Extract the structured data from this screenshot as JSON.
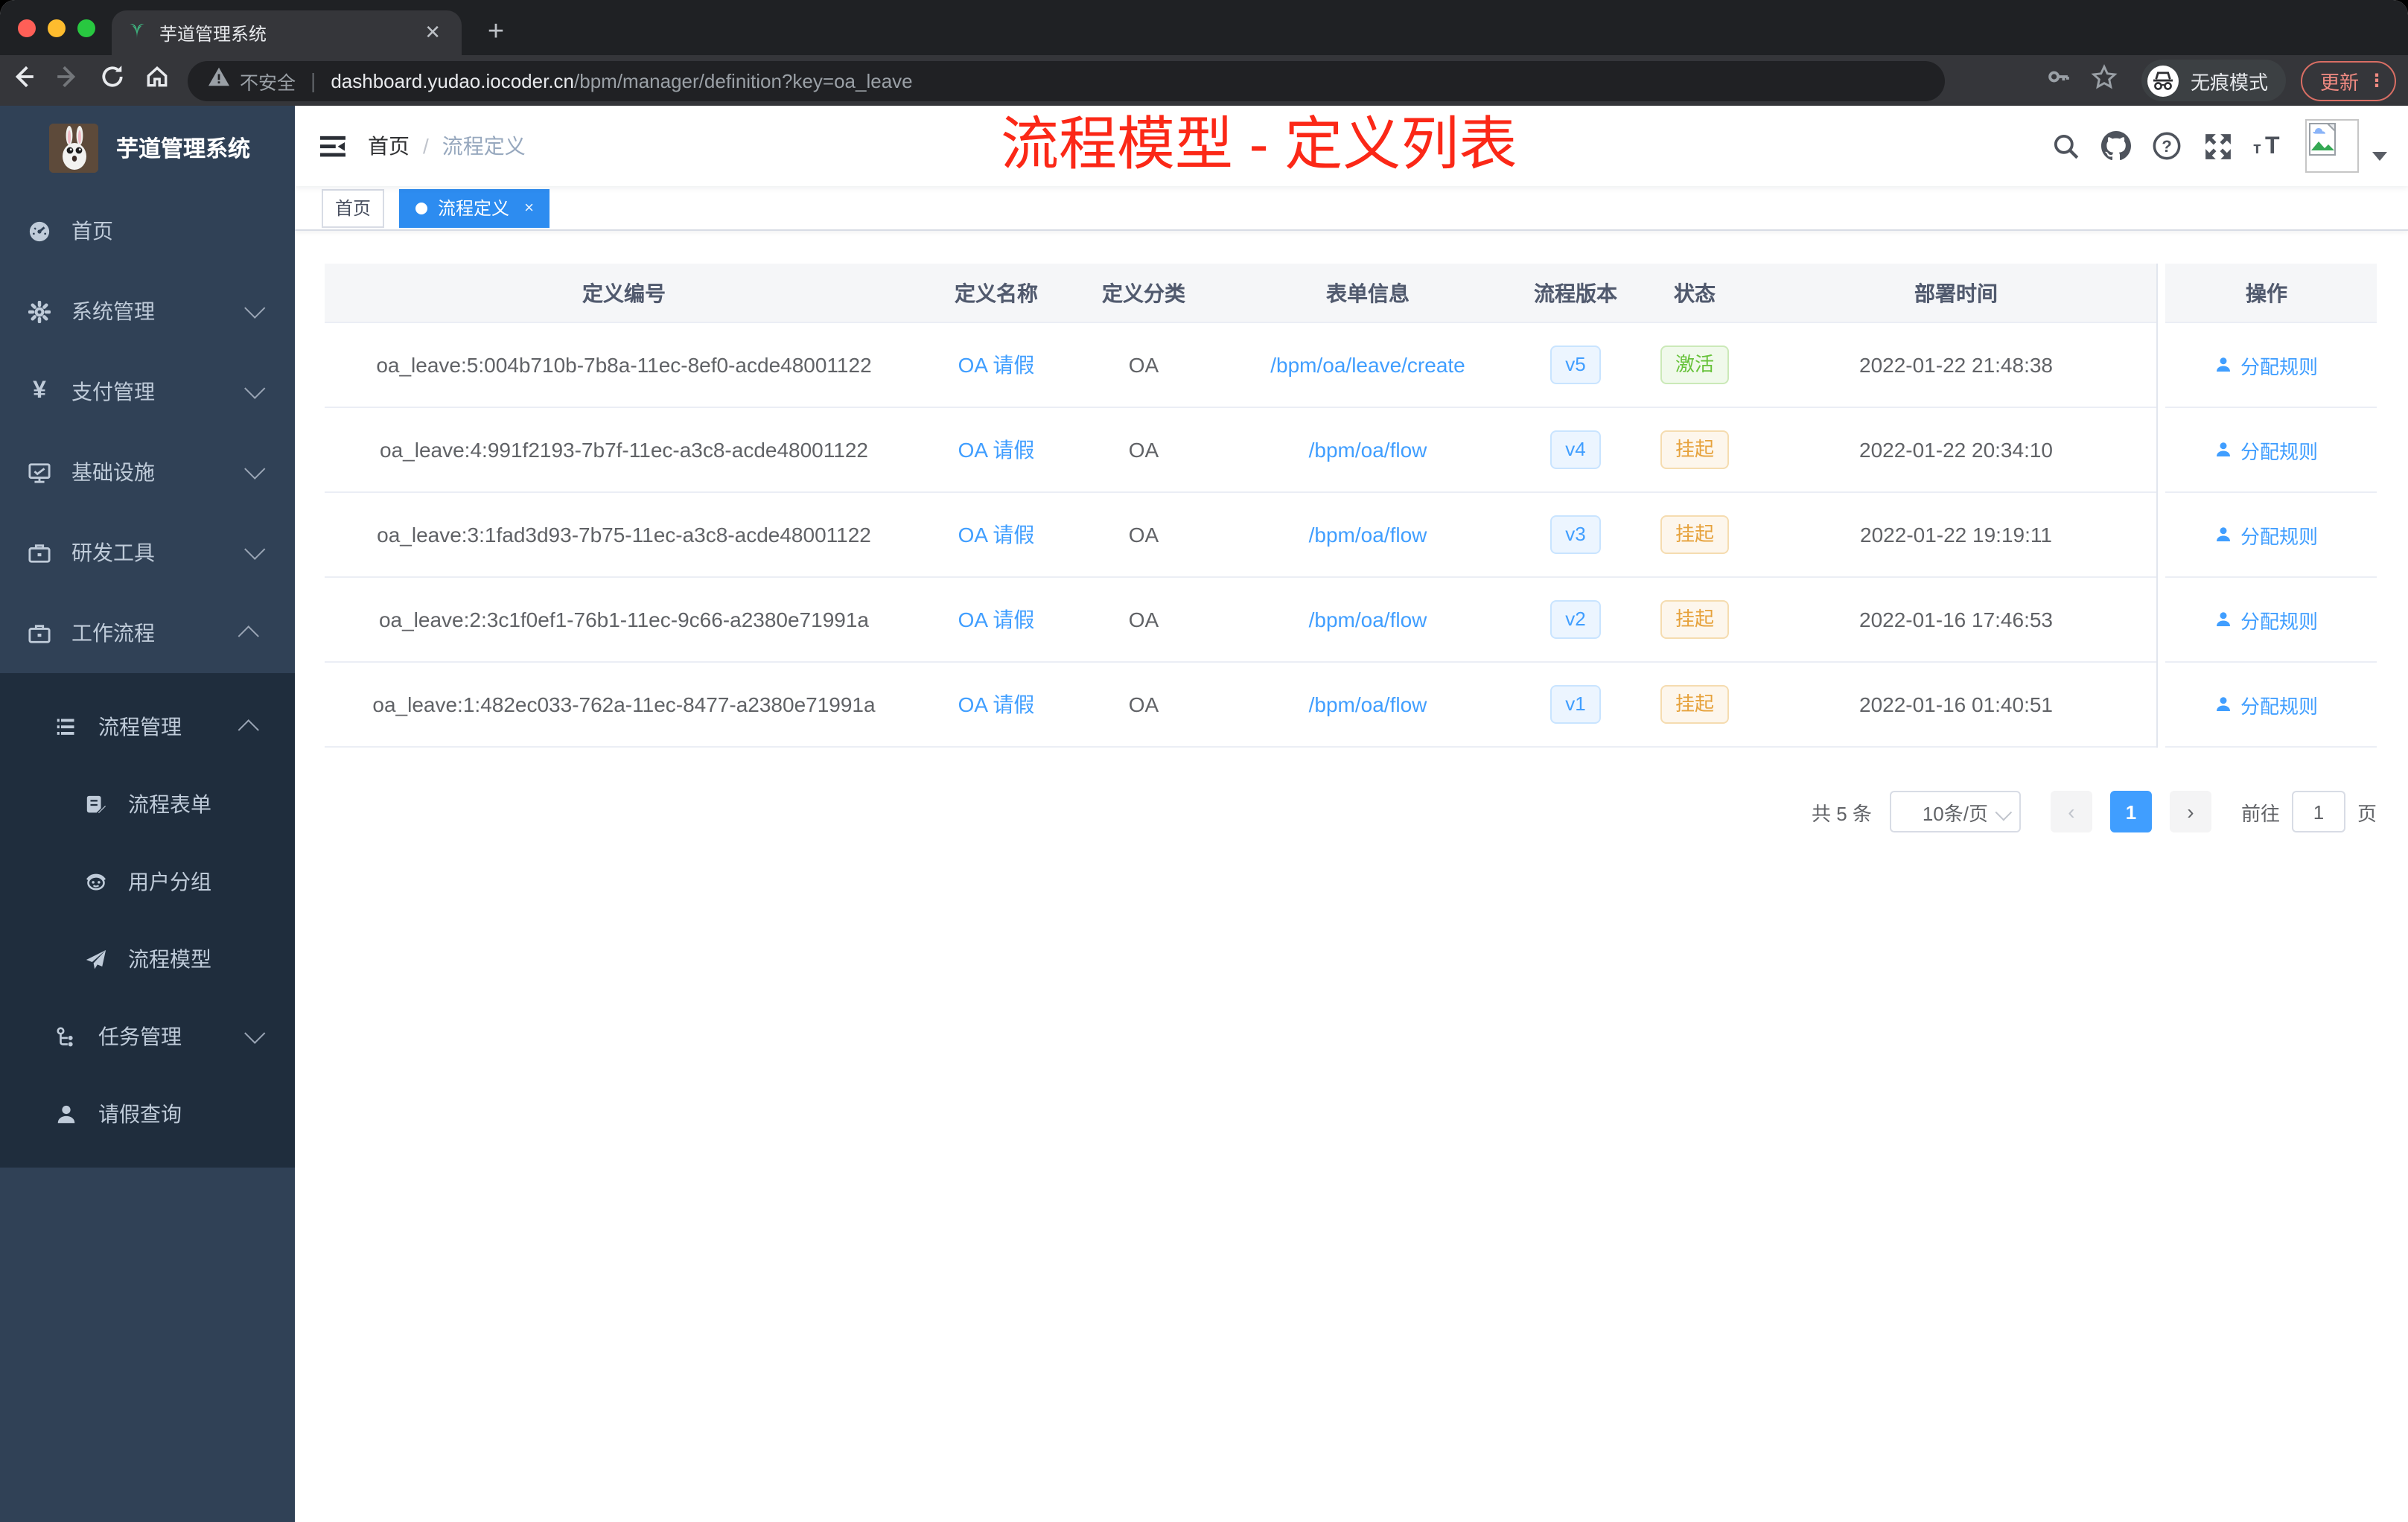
{
  "browser": {
    "tab_title": "芋道管理系统",
    "new_tab": "+",
    "close_tab": "✕",
    "security_text": "不安全",
    "url_host": "dashboard.yudao.iocoder.cn",
    "url_path": "/bpm/manager/definition?key=oa_leave",
    "incognito_label": "无痕模式",
    "update_label": "更新"
  },
  "sidebar": {
    "logo_title": "芋道管理系统",
    "items": [
      {
        "label": "首页"
      },
      {
        "label": "系统管理"
      },
      {
        "label": "支付管理"
      },
      {
        "label": "基础设施"
      },
      {
        "label": "研发工具"
      },
      {
        "label": "工作流程"
      },
      {
        "label": "流程管理"
      },
      {
        "label": "流程表单"
      },
      {
        "label": "用户分组"
      },
      {
        "label": "流程模型"
      },
      {
        "label": "任务管理"
      },
      {
        "label": "请假查询"
      }
    ]
  },
  "header": {
    "breadcrumb_home": "首页",
    "breadcrumb_separator": "/",
    "breadcrumb_current": "流程定义",
    "overlay_title": "流程模型 - 定义列表"
  },
  "tags": {
    "home": "首页",
    "active": "流程定义",
    "close": "×"
  },
  "table": {
    "columns": [
      "定义编号",
      "定义名称",
      "定义分类",
      "表单信息",
      "流程版本",
      "状态",
      "部署时间",
      "操作"
    ],
    "action_label": "分配规则",
    "rows": [
      {
        "id": "oa_leave:5:004b710b-7b8a-11ec-8ef0-acde48001122",
        "name": "OA 请假",
        "category": "OA",
        "form": "/bpm/oa/leave/create",
        "version": "v5",
        "status": "激活",
        "status_type": "success",
        "time": "2022-01-22 21:48:38"
      },
      {
        "id": "oa_leave:4:991f2193-7b7f-11ec-a3c8-acde48001122",
        "name": "OA 请假",
        "category": "OA",
        "form": "/bpm/oa/flow",
        "version": "v4",
        "status": "挂起",
        "status_type": "warning",
        "time": "2022-01-22 20:34:10"
      },
      {
        "id": "oa_leave:3:1fad3d93-7b75-11ec-a3c8-acde48001122",
        "name": "OA 请假",
        "category": "OA",
        "form": "/bpm/oa/flow",
        "version": "v3",
        "status": "挂起",
        "status_type": "warning",
        "time": "2022-01-22 19:19:11"
      },
      {
        "id": "oa_leave:2:3c1f0ef1-76b1-11ec-9c66-a2380e71991a",
        "name": "OA 请假",
        "category": "OA",
        "form": "/bpm/oa/flow",
        "version": "v2",
        "status": "挂起",
        "status_type": "warning",
        "time": "2022-01-16 17:46:53"
      },
      {
        "id": "oa_leave:1:482ec033-762a-11ec-8477-a2380e71991a",
        "name": "OA 请假",
        "category": "OA",
        "form": "/bpm/oa/flow",
        "version": "v1",
        "status": "挂起",
        "status_type": "warning",
        "time": "2022-01-16 01:40:51"
      }
    ]
  },
  "pagination": {
    "total": "共 5 条",
    "page_size": "10条/页",
    "page": "1",
    "goto_label": "前往",
    "goto_value": "1",
    "unit_label": "页"
  },
  "colors": {
    "accent": "#409eff",
    "success": "#67c23a",
    "warning": "#e6a23c",
    "annotation_red": "#fb2817",
    "sidebar_bg": "#304156",
    "submenu_bg": "#1f2d3d"
  }
}
